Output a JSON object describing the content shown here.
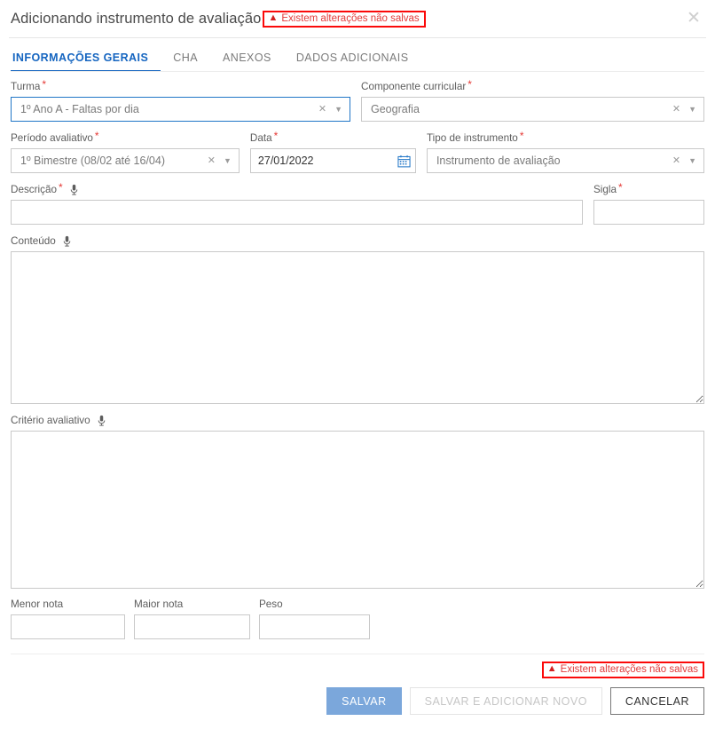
{
  "header": {
    "title": "Adicionando instrumento de avaliação",
    "alert": "Existem alterações não salvas",
    "warn_icon": "warning-triangle-icon",
    "close_icon": "close-icon"
  },
  "tabs": [
    {
      "label": "INFORMAÇÕES GERAIS",
      "active": true
    },
    {
      "label": "CHA",
      "active": false
    },
    {
      "label": "ANEXOS",
      "active": false
    },
    {
      "label": "DADOS ADICIONAIS",
      "active": false
    }
  ],
  "fields": {
    "turma": {
      "label": "Turma",
      "required": "*",
      "value": "1º Ano A - Faltas por dia",
      "clear_icon": "clear-icon",
      "chevron_icon": "chevron-down-icon"
    },
    "componente": {
      "label": "Componente curricular",
      "required": "*",
      "value": "Geografia",
      "clear_icon": "clear-icon",
      "chevron_icon": "chevron-down-icon"
    },
    "periodo": {
      "label": "Período avaliativo",
      "required": "*",
      "value": "1º Bimestre (08/02 até 16/04)",
      "clear_icon": "clear-icon",
      "chevron_icon": "chevron-down-icon"
    },
    "data": {
      "label": "Data",
      "required": "*",
      "value": "27/01/2022",
      "calendar_icon": "calendar-icon"
    },
    "tipo": {
      "label": "Tipo de instrumento",
      "required": "*",
      "value": "Instrumento de avaliação",
      "clear_icon": "clear-icon",
      "chevron_icon": "chevron-down-icon"
    },
    "descricao": {
      "label": "Descrição",
      "required": "*",
      "value": "",
      "mic_icon": "microphone-icon"
    },
    "sigla": {
      "label": "Sigla",
      "required": "*",
      "value": ""
    },
    "conteudo": {
      "label": "Conteúdo",
      "value": "",
      "mic_icon": "microphone-icon"
    },
    "criterio": {
      "label": "Critério avaliativo",
      "value": "",
      "mic_icon": "microphone-icon"
    },
    "menor_nota": {
      "label": "Menor nota",
      "value": ""
    },
    "maior_nota": {
      "label": "Maior nota",
      "value": ""
    },
    "peso": {
      "label": "Peso",
      "value": ""
    }
  },
  "footer": {
    "alert": "Existem alterações não salvas",
    "warn_icon": "warning-triangle-icon",
    "save_label": "SALVAR",
    "save_add_label": "SALVAR E ADICIONAR NOVO",
    "cancel_label": "CANCELAR"
  },
  "colors": {
    "accent_blue": "#1565c0",
    "primary_button": "#7ba7db",
    "alert_red": "#e23b3b",
    "alert_border": "#fb0a0a",
    "required_red": "#e53935",
    "border_gray": "#c9c9c9",
    "focus_blue": "#2176c7"
  }
}
